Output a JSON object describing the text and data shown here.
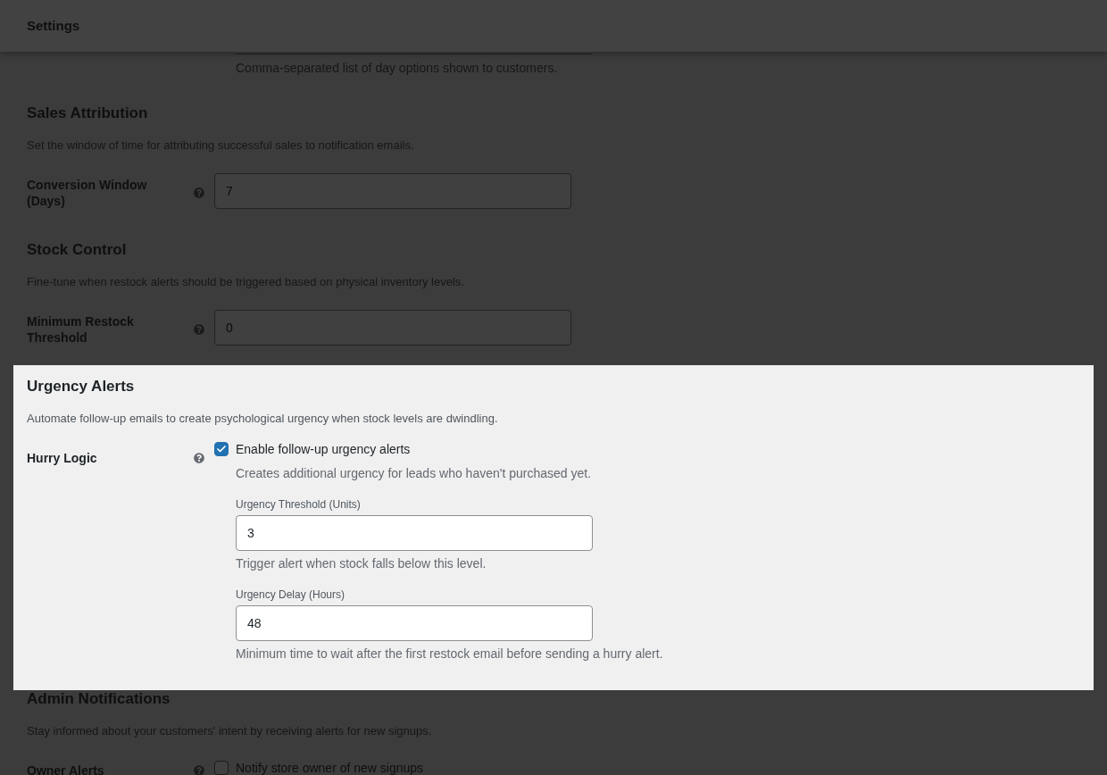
{
  "header": {
    "title": "Settings"
  },
  "cut_off_field": {
    "hint": "Comma-separated list of day options shown to customers."
  },
  "sections": [
    {
      "title": "Sales Attribution",
      "description": "Set the window of time for attributing successful sales to notification emails.",
      "highlighted": false,
      "rows": [
        {
          "kind": "number",
          "label": "Conversion Window (Days)",
          "value": "7"
        }
      ]
    },
    {
      "title": "Stock Control",
      "description": "Fine-tune when restock alerts should be triggered based on physical inventory levels.",
      "highlighted": false,
      "rows": [
        {
          "kind": "number",
          "label": "Minimum Restock Threshold",
          "value": "0"
        }
      ]
    },
    {
      "title": "Urgency Alerts",
      "description": "Automate follow-up emails to create psychological urgency when stock levels are dwindling.",
      "highlighted": true,
      "rows": [
        {
          "kind": "checkbox_group",
          "label": "Hurry Logic",
          "checkbox": {
            "label": "Enable follow-up urgency alerts",
            "checked": true
          },
          "hint": "Creates additional urgency for leads who haven't purchased yet.",
          "subfields": [
            {
              "label": "Urgency Threshold (Units)",
              "value": "3",
              "hint": "Trigger alert when stock falls below this level."
            },
            {
              "label": "Urgency Delay (Hours)",
              "value": "48",
              "hint": "Minimum time to wait after the first restock email before sending a hurry alert."
            }
          ]
        }
      ]
    },
    {
      "title": "Admin Notifications",
      "description": "Stay informed about your customers' intent by receiving alerts for new signups.",
      "highlighted": false,
      "rows": [
        {
          "kind": "checkbox",
          "label": "Owner Alerts",
          "checkbox": {
            "label": "Notify store owner of new signups",
            "checked": false
          }
        }
      ]
    }
  ]
}
